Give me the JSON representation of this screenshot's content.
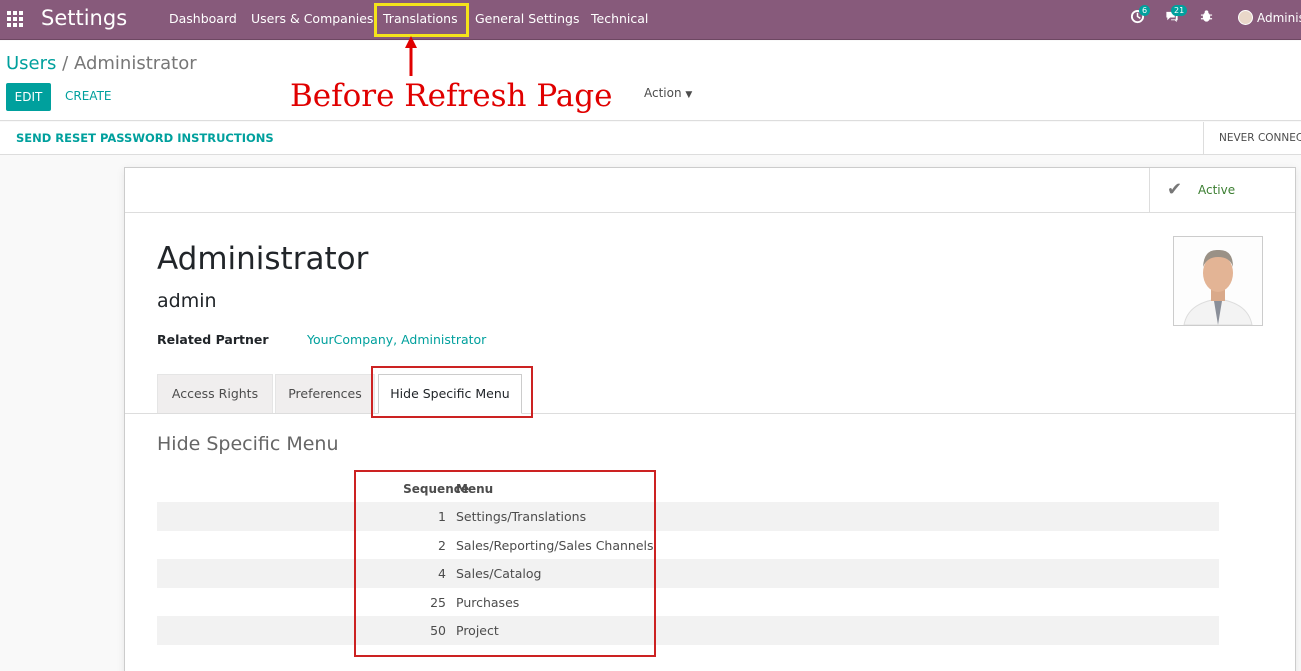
{
  "navbar": {
    "brand": "Settings",
    "menu": [
      "Dashboard",
      "Users & Companies",
      "Translations",
      "General Settings",
      "Technical"
    ],
    "activity_count": "6",
    "message_count": "21",
    "user_name": "Adminis"
  },
  "breadcrumb": {
    "parent": "Users",
    "separator": "/",
    "current": "Administrator"
  },
  "buttons": {
    "edit": "EDIT",
    "create": "CREATE",
    "action": "Action"
  },
  "annotation": "Before Refresh Page",
  "statusbar": {
    "reset_password": "SEND RESET PASSWORD INSTRUCTIONS",
    "never_connected": "NEVER CONNECTED"
  },
  "form": {
    "active_label": "Active",
    "name": "Administrator",
    "login": "admin",
    "related_partner_label": "Related Partner",
    "related_partner_value": "YourCompany, Administrator"
  },
  "tabs": [
    "Access Rights",
    "Preferences",
    "Hide Specific Menu"
  ],
  "hide_menu": {
    "title": "Hide Specific Menu",
    "columns": {
      "sequence": "Sequence",
      "menu": "Menu"
    },
    "rows": [
      {
        "sequence": "1",
        "menu": "Settings/Translations"
      },
      {
        "sequence": "2",
        "menu": "Sales/Reporting/Sales Channels"
      },
      {
        "sequence": "4",
        "menu": "Sales/Catalog"
      },
      {
        "sequence": "25",
        "menu": "Purchases"
      },
      {
        "sequence": "50",
        "menu": "Project"
      }
    ]
  },
  "colors": {
    "navbar": "#875a7b",
    "accent": "#00a09d",
    "annotation": "#e00000",
    "highlight": "#f5e31b"
  }
}
